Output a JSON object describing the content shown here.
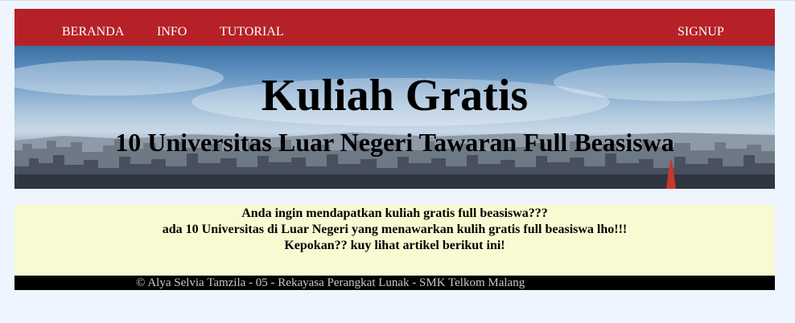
{
  "nav": {
    "items": [
      {
        "label": "BERANDA"
      },
      {
        "label": "INFO"
      },
      {
        "label": "TUTORIAL"
      }
    ],
    "signup_label": "SIGNUP"
  },
  "hero": {
    "title": "Kuliah Gratis",
    "subtitle": "10 Universitas Luar Negeri Tawaran Full Beasiswa"
  },
  "content": {
    "lines": [
      "Anda ingin mendapatkan kuliah gratis full beasiswa???",
      "ada 10 Universitas di Luar Negeri yang menawarkan kulih gratis full beasiswa lho!!!",
      "Kepokan?? kuy lihat artikel berikut ini!"
    ]
  },
  "footer": {
    "text": "© Alya Selvia Tamzila - 05 - Rekayasa Perangkat Lunak - SMK Telkom Malang"
  },
  "colors": {
    "navbar": "#b52126",
    "content_bg": "#fafad2",
    "page_bg": "#eef5fe",
    "footer_bg": "#000000"
  }
}
